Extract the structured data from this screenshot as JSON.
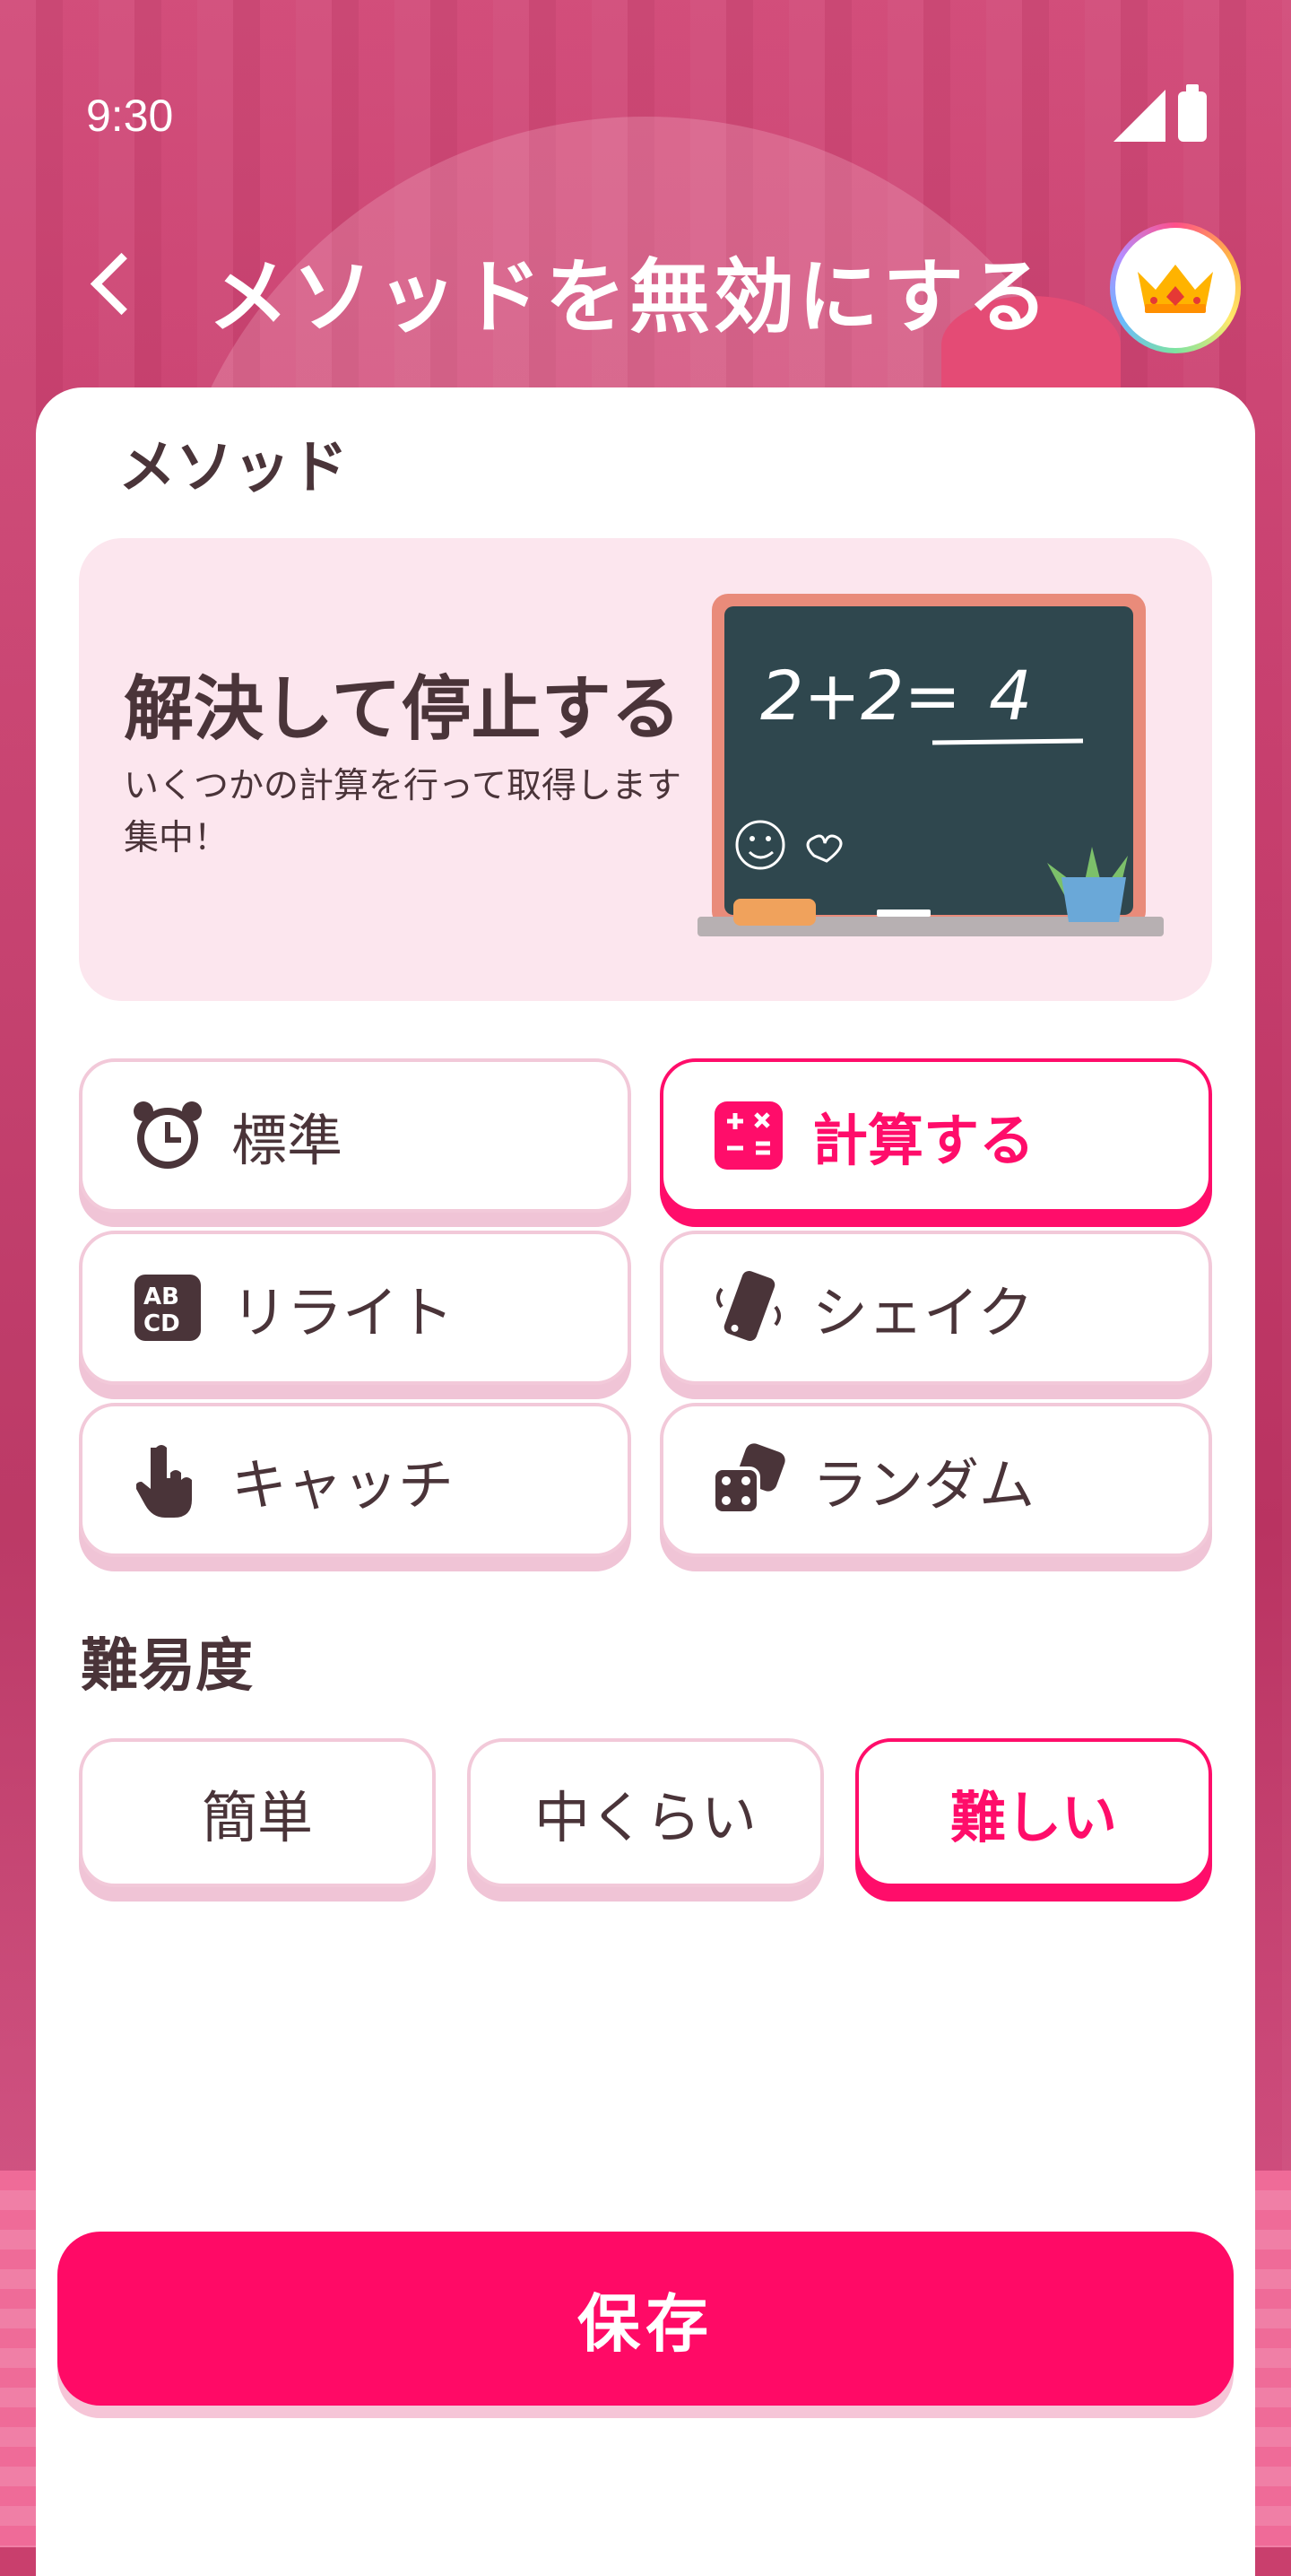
{
  "status_bar": {
    "time": "9:30"
  },
  "header": {
    "title": "メソッドを無効にする"
  },
  "method_section": {
    "title": "メソッド",
    "hero": {
      "title": "解決して停止する",
      "description": "いくつかの計算を行って取得します集中！",
      "illustration": {
        "equation": "2+2=",
        "answer": "4"
      }
    },
    "options": [
      {
        "label": "標準",
        "icon": "alarm-clock-icon",
        "selected": false
      },
      {
        "label": "計算する",
        "icon": "calculator-icon",
        "selected": true
      },
      {
        "label": "リライト",
        "icon": "abcd-icon",
        "selected": false
      },
      {
        "label": "シェイク",
        "icon": "phone-shake-icon",
        "selected": false
      },
      {
        "label": "キャッチ",
        "icon": "hand-pointer-icon",
        "selected": false
      },
      {
        "label": "ランダム",
        "icon": "dice-icon",
        "selected": false
      }
    ]
  },
  "difficulty_section": {
    "title": "難易度",
    "options": [
      {
        "label": "簡単",
        "selected": false
      },
      {
        "label": "中くらい",
        "selected": false
      },
      {
        "label": "難しい",
        "selected": true
      }
    ]
  },
  "save_button": {
    "label": "保存"
  },
  "colors": {
    "accent": "#ff0d6a",
    "text": "#4a3439",
    "hero_bg": "#fce6ee",
    "border": "#f2c9d9",
    "background": "#c93f6d"
  }
}
